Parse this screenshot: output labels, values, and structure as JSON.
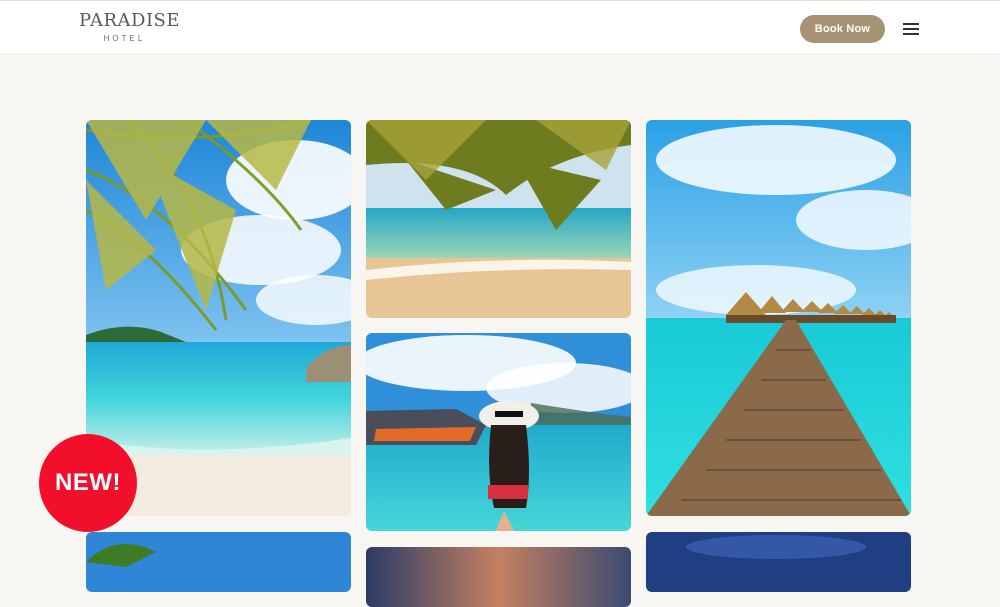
{
  "header": {
    "logo": {
      "name": "PARADISE",
      "sub": "HOTEL"
    },
    "book_label": "Book Now",
    "menu_icon": "hamburger-menu-icon"
  },
  "badge": {
    "text": "NEW!",
    "color": "#f20f2c"
  },
  "colors": {
    "accent": "#a79373",
    "page_bg": "#f8f6f2"
  },
  "gallery": {
    "photos": [
      {
        "subject": "palm-leaves-over-turquoise-beach"
      },
      {
        "subject": "palm-fronds-sandy-shore"
      },
      {
        "subject": "overwater-bungalows-wooden-pier"
      },
      {
        "subject": "woman-in-sun-hat-with-speedboat"
      },
      {
        "subject": "palm-tree-blue-sky"
      },
      {
        "subject": "sunset-sky"
      },
      {
        "subject": "night-sky"
      }
    ]
  }
}
